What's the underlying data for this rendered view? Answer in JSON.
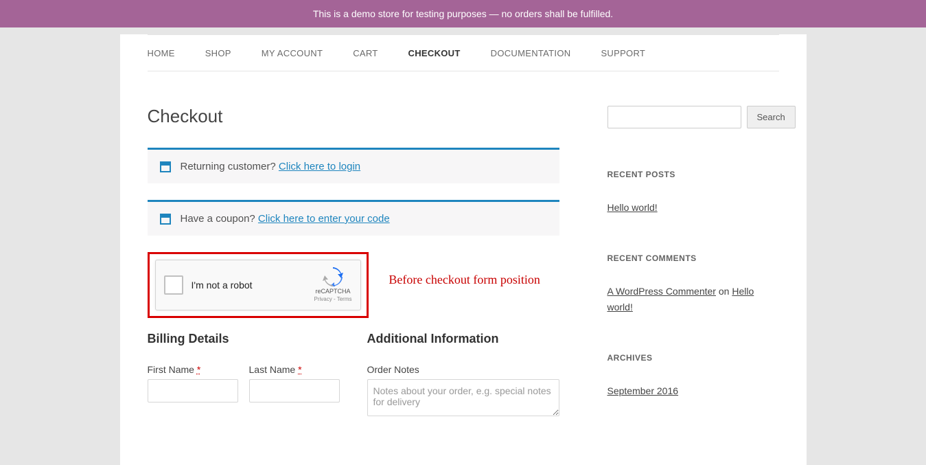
{
  "banner": "This is a demo store for testing purposes — no orders shall be fulfilled.",
  "nav": {
    "home": "HOME",
    "shop": "SHOP",
    "my_account": "MY ACCOUNT",
    "cart": "CART",
    "checkout": "CHECKOUT",
    "documentation": "DOCUMENTATION",
    "support": "SUPPORT"
  },
  "page_title": "Checkout",
  "notices": {
    "returning_prefix": "Returning customer? ",
    "returning_link": "Click here to login",
    "coupon_prefix": "Have a coupon? ",
    "coupon_link": "Click here to enter your code"
  },
  "recaptcha": {
    "label": "I'm not a robot",
    "brand": "reCAPTCHA",
    "sub": "Privacy - Terms"
  },
  "annotation": "Before checkout form position",
  "billing": {
    "heading": "Billing Details",
    "first_name": "First Name",
    "last_name": "Last Name",
    "req": "*"
  },
  "additional": {
    "heading": "Additional Information",
    "order_notes": "Order Notes",
    "order_notes_placeholder": "Notes about your order, e.g. special notes for delivery"
  },
  "sidebar": {
    "search_btn": "Search",
    "recent_posts": {
      "title": "RECENT POSTS",
      "item": "Hello world!"
    },
    "recent_comments": {
      "title": "RECENT COMMENTS",
      "author": "A WordPress Commenter",
      "on": " on ",
      "post": "Hello world!"
    },
    "archives": {
      "title": "ARCHIVES",
      "item": "September 2016"
    }
  }
}
